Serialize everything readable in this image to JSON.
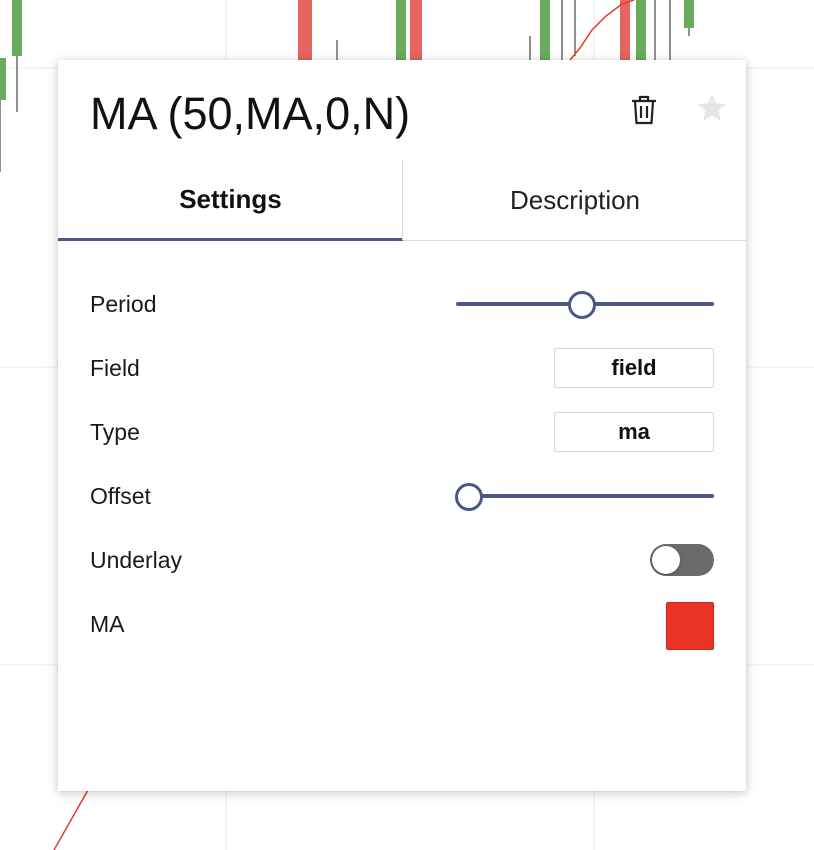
{
  "dialog": {
    "title": "MA (50,MA,0,N)",
    "icons": {
      "delete": "trash-icon",
      "favorite": "star-icon"
    }
  },
  "tabs": [
    {
      "label": "Settings",
      "active": true
    },
    {
      "label": "Description",
      "active": false
    }
  ],
  "settings": {
    "period": {
      "label": "Period",
      "value_fraction": 0.49
    },
    "field": {
      "label": "Field",
      "value": "field"
    },
    "type": {
      "label": "Type",
      "value": "ma"
    },
    "offset": {
      "label": "Offset",
      "value_fraction": 0.05
    },
    "underlay": {
      "label": "Underlay",
      "on": false
    },
    "ma_color": {
      "label": "MA",
      "color": "#ea3324"
    }
  },
  "colors": {
    "accent": "#4d5689",
    "candle_up": "#6aaa5a",
    "candle_down": "#e46460",
    "ma_line": "#e23c2c",
    "grid": "#e9e9e9"
  }
}
